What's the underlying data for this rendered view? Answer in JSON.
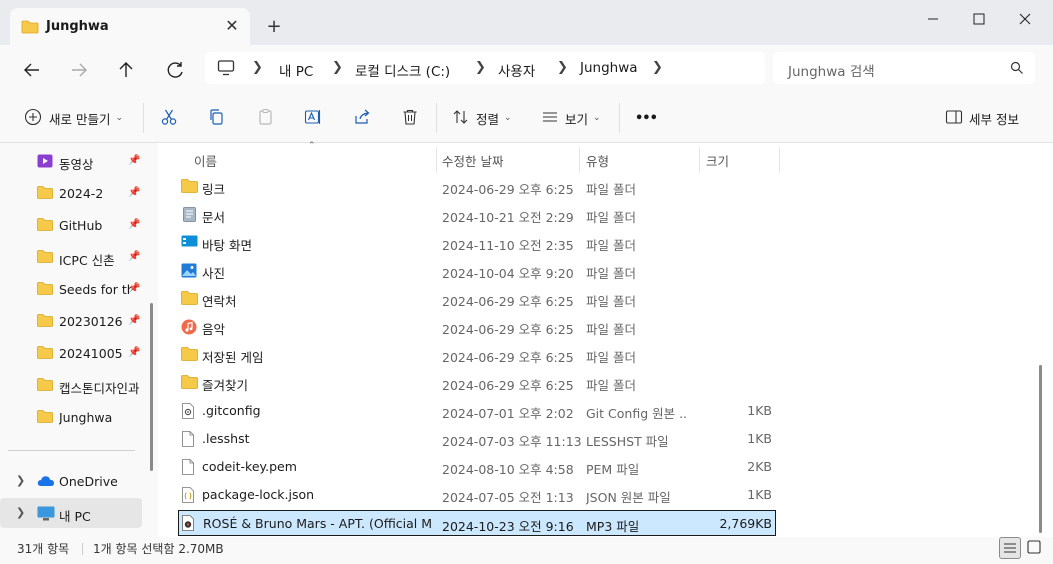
{
  "window": {
    "tab_title": "Junghwa",
    "tab_close": "✕",
    "new_tab": "+"
  },
  "nav": {
    "breadcrumbs": [
      "내 PC",
      "로컬 디스크 (C:)",
      "사용자",
      "Junghwa"
    ],
    "search_placeholder": "Junghwa 검색"
  },
  "toolbar": {
    "new_label": "새로 만들기",
    "sort_label": "정렬",
    "view_label": "보기",
    "more_label": "•••",
    "details_label": "세부 정보"
  },
  "sidebar": {
    "items": [
      {
        "label": "동영상",
        "icon": "video-folder-icon",
        "pinned": true
      },
      {
        "label": "2024-2",
        "icon": "folder-icon",
        "pinned": true
      },
      {
        "label": "GitHub",
        "icon": "folder-icon",
        "pinned": true
      },
      {
        "label": "ICPC 신촌",
        "icon": "folder-icon",
        "pinned": true
      },
      {
        "label": "Seeds for the",
        "icon": "folder-icon",
        "pinned": true
      },
      {
        "label": "20230126",
        "icon": "folder-icon",
        "pinned": true
      },
      {
        "label": "20241005",
        "icon": "folder-icon",
        "pinned": true
      },
      {
        "label": "캡스톤디자인과",
        "icon": "folder-icon",
        "pinned": false
      },
      {
        "label": "Junghwa",
        "icon": "folder-icon",
        "pinned": false
      }
    ],
    "onedrive": "OneDrive",
    "thispc": "내 PC"
  },
  "columns": {
    "name": "이름",
    "modified": "수정한 날짜",
    "type": "유형",
    "size": "크기"
  },
  "files": [
    {
      "name": "링크",
      "modified": "2024-06-29 오후 6:25",
      "type": "파일 폴더",
      "size": "",
      "icon": "folder-icon"
    },
    {
      "name": "문서",
      "modified": "2024-10-21 오전 2:29",
      "type": "파일 폴더",
      "size": "",
      "icon": "documents-icon"
    },
    {
      "name": "바탕 화면",
      "modified": "2024-11-10 오전 2:35",
      "type": "파일 폴더",
      "size": "",
      "icon": "desktop-icon"
    },
    {
      "name": "사진",
      "modified": "2024-10-04 오후 9:20",
      "type": "파일 폴더",
      "size": "",
      "icon": "pictures-icon"
    },
    {
      "name": "연락처",
      "modified": "2024-06-29 오후 6:25",
      "type": "파일 폴더",
      "size": "",
      "icon": "folder-icon"
    },
    {
      "name": "음악",
      "modified": "2024-06-29 오후 6:25",
      "type": "파일 폴더",
      "size": "",
      "icon": "music-icon"
    },
    {
      "name": "저장된 게임",
      "modified": "2024-06-29 오후 6:25",
      "type": "파일 폴더",
      "size": "",
      "icon": "folder-icon"
    },
    {
      "name": "즐겨찾기",
      "modified": "2024-06-29 오후 6:25",
      "type": "파일 폴더",
      "size": "",
      "icon": "folder-icon"
    },
    {
      "name": ".gitconfig",
      "modified": "2024-07-01 오후 2:02",
      "type": "Git Config 원본 ...",
      "size": "1KB",
      "icon": "config-file-icon"
    },
    {
      "name": ".lesshst",
      "modified": "2024-07-03 오후 11:13",
      "type": "LESSHST 파일",
      "size": "1KB",
      "icon": "file-icon"
    },
    {
      "name": "codeit-key.pem",
      "modified": "2024-08-10 오후 4:58",
      "type": "PEM 파일",
      "size": "2KB",
      "icon": "file-icon"
    },
    {
      "name": "package-lock.json",
      "modified": "2024-07-05 오전 1:13",
      "type": "JSON 원본 파일",
      "size": "1KB",
      "icon": "json-file-icon"
    },
    {
      "name": "ROSÉ & Bruno Mars - APT. (Official Mu...",
      "modified": "2024-10-23 오전 9:16",
      "type": "MP3 파일",
      "size": "2,769KB",
      "icon": "mp3-file-icon",
      "selected": true
    }
  ],
  "status": {
    "count": "31개 항목",
    "selection": "1개 항목 선택함 2.70MB"
  },
  "colors": {
    "selection": "#cce8ff",
    "folder": "#f7c948",
    "accent": "#0067c0"
  }
}
